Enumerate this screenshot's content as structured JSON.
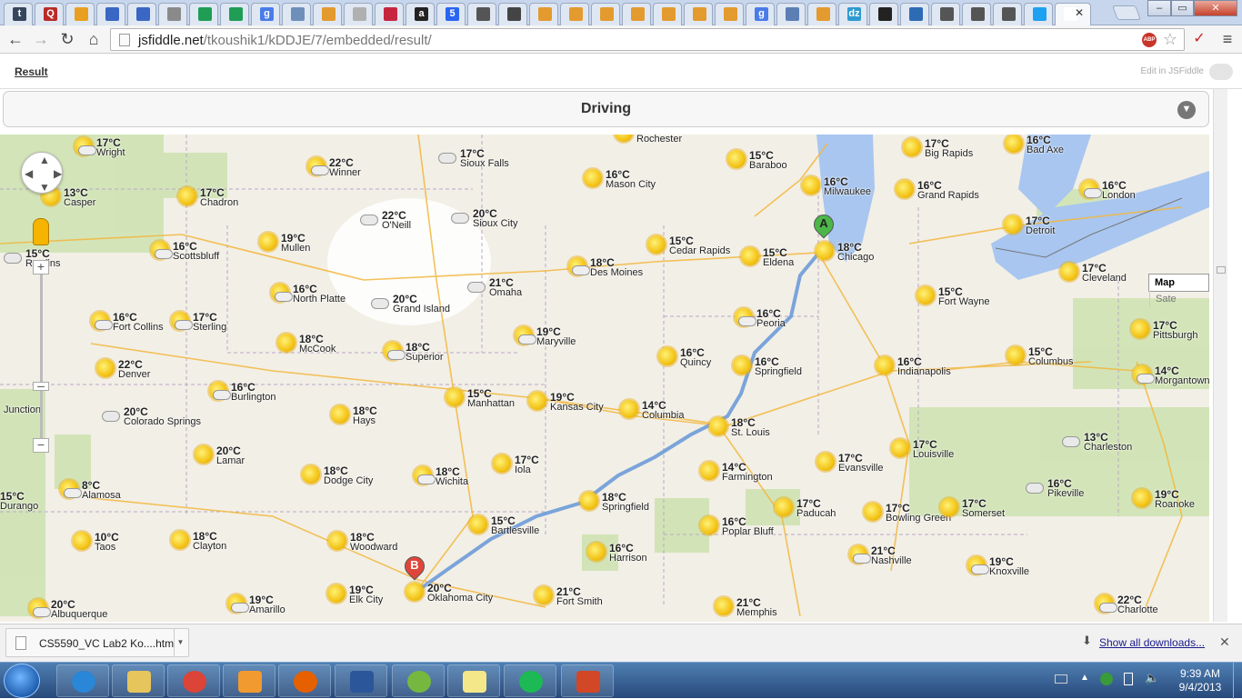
{
  "browser": {
    "address_host": "jsfiddle.net",
    "address_path": "/tkoushik1/kDDJE/7/embedded/result/",
    "tabs": [
      {
        "icon": "tumblr-icon",
        "color": "#35465c",
        "glyph": "t"
      },
      {
        "icon": "quora-icon",
        "color": "#b92b27",
        "glyph": "Q"
      },
      {
        "icon": "windows-icon",
        "color": "#e9a020",
        "glyph": ""
      },
      {
        "icon": "doc-icon",
        "color": "#3a66c4",
        "glyph": ""
      },
      {
        "icon": "doc-icon",
        "color": "#3a66c4",
        "glyph": ""
      },
      {
        "icon": "bb-icon",
        "color": "#8a8a8a",
        "glyph": ""
      },
      {
        "icon": "sheets-icon",
        "color": "#1f9d55",
        "glyph": ""
      },
      {
        "icon": "sheets-icon",
        "color": "#1f9d55",
        "glyph": ""
      },
      {
        "icon": "google-icon",
        "color": "#4a7ce8",
        "glyph": "g"
      },
      {
        "icon": "swirl-icon",
        "color": "#6d8fb9",
        "glyph": ""
      },
      {
        "icon": "stack-icon",
        "color": "#e39a2e",
        "glyph": ""
      },
      {
        "icon": "stack-icon",
        "color": "#b0b0b0",
        "glyph": ""
      },
      {
        "icon": "tw-icon",
        "color": "#c7253e",
        "glyph": ""
      },
      {
        "icon": "amazon-icon",
        "color": "#222222",
        "glyph": "a"
      },
      {
        "icon": "css-icon",
        "color": "#2965f1",
        "glyph": "5"
      },
      {
        "icon": "doc-icon",
        "color": "#555555",
        "glyph": ""
      },
      {
        "icon": "book-icon",
        "color": "#444444",
        "glyph": ""
      },
      {
        "icon": "stack-icon",
        "color": "#e39a2e",
        "glyph": ""
      },
      {
        "icon": "stack-icon",
        "color": "#e39a2e",
        "glyph": ""
      },
      {
        "icon": "stack-icon",
        "color": "#e39a2e",
        "glyph": ""
      },
      {
        "icon": "stack-icon",
        "color": "#e39a2e",
        "glyph": ""
      },
      {
        "icon": "stack-icon",
        "color": "#e39a2e",
        "glyph": ""
      },
      {
        "icon": "stack-icon",
        "color": "#e39a2e",
        "glyph": ""
      },
      {
        "icon": "stack-icon",
        "color": "#e39a2e",
        "glyph": ""
      },
      {
        "icon": "google-icon",
        "color": "#4a7ce8",
        "glyph": "g"
      },
      {
        "icon": "p-icon",
        "color": "#5b7fb5",
        "glyph": ""
      },
      {
        "icon": "stack-icon",
        "color": "#e39a2e",
        "glyph": ""
      },
      {
        "icon": "dzone-icon",
        "color": "#2e9ad0",
        "glyph": "dz"
      },
      {
        "icon": "github-icon",
        "color": "#222222",
        "glyph": ""
      },
      {
        "icon": "arrow-icon",
        "color": "#2e6bb5",
        "glyph": ""
      },
      {
        "icon": "mask-icon",
        "color": "#555555",
        "glyph": ""
      },
      {
        "icon": "mask-icon",
        "color": "#555555",
        "glyph": ""
      },
      {
        "icon": "mask-icon",
        "color": "#555555",
        "glyph": ""
      },
      {
        "icon": "twitter-icon",
        "color": "#1da1f2",
        "glyph": ""
      },
      {
        "icon": "blank-icon",
        "color": "#ffffff",
        "glyph": "",
        "active": true
      }
    ]
  },
  "fiddle": {
    "result_label": "Result",
    "edit_label": "Edit in JSFiddle"
  },
  "panel": {
    "mode": "Driving"
  },
  "map": {
    "type_buttons": [
      "Map",
      "Sate"
    ],
    "markers": [
      {
        "label": "A",
        "color": "#4cb648"
      },
      {
        "label": "B",
        "color": "#e0453a"
      }
    ],
    "weather": [
      {
        "t": "17°C",
        "c": "Wright",
        "k": "partly"
      },
      {
        "t": "22°C",
        "c": "Winner",
        "k": "partly"
      },
      {
        "t": "17°C",
        "c": "Sioux Falls",
        "k": "cloud"
      },
      {
        "t": "",
        "c": "Rochester",
        "k": "sun"
      },
      {
        "t": "15°C",
        "c": "Baraboo",
        "k": "sun"
      },
      {
        "t": "17°C",
        "c": "Big Rapids",
        "k": "sun"
      },
      {
        "t": "16°C",
        "c": "Bad Axe",
        "k": "sun"
      },
      {
        "t": "13°C",
        "c": "Casper",
        "k": "sun"
      },
      {
        "t": "17°C",
        "c": "Chadron",
        "k": "sun"
      },
      {
        "t": "16°C",
        "c": "Mason City",
        "k": "sun"
      },
      {
        "t": "16°C",
        "c": "Milwaukee",
        "k": "sun"
      },
      {
        "t": "16°C",
        "c": "Grand Rapids",
        "k": "sun"
      },
      {
        "t": "16°C",
        "c": "London",
        "k": "partly"
      },
      {
        "t": "22°C",
        "c": "O'Neill",
        "k": "cloud"
      },
      {
        "t": "20°C",
        "c": "Sioux City",
        "k": "cloud"
      },
      {
        "t": "17°C",
        "c": "Detroit",
        "k": "sun"
      },
      {
        "t": "15°C",
        "c": "Rawlins",
        "k": "cloud"
      },
      {
        "t": "16°C",
        "c": "Scottsbluff",
        "k": "partly"
      },
      {
        "t": "19°C",
        "c": "Mullen",
        "k": "sun"
      },
      {
        "t": "15°C",
        "c": "Cedar Rapids",
        "k": "sun"
      },
      {
        "t": "15°C",
        "c": "Eldena",
        "k": "sun"
      },
      {
        "t": "18°C",
        "c": "Chicago",
        "k": "sun"
      },
      {
        "t": "18°C",
        "c": "Des Moines",
        "k": "partly"
      },
      {
        "t": "21°C",
        "c": "Omaha",
        "k": "cloud"
      },
      {
        "t": "17°C",
        "c": "Cleveland",
        "k": "sun"
      },
      {
        "t": "16°C",
        "c": "North Platte",
        "k": "partly"
      },
      {
        "t": "20°C",
        "c": "Grand Island",
        "k": "cloud"
      },
      {
        "t": "15°C",
        "c": "Fort Wayne",
        "k": "sun"
      },
      {
        "t": "16°C",
        "c": "Fort Collins",
        "k": "partly"
      },
      {
        "t": "17°C",
        "c": "Sterling",
        "k": "partly"
      },
      {
        "t": "16°C",
        "c": "Peoria",
        "k": "partly"
      },
      {
        "t": "17°C",
        "c": "Pittsburgh",
        "k": "sun"
      },
      {
        "t": "18°C",
        "c": "McCook",
        "k": "sun"
      },
      {
        "t": "19°C",
        "c": "Maryville",
        "k": "partly"
      },
      {
        "t": "18°C",
        "c": "Superior",
        "k": "partly"
      },
      {
        "t": "16°C",
        "c": "Quincy",
        "k": "sun"
      },
      {
        "t": "16°C",
        "c": "Springfield",
        "k": "sun"
      },
      {
        "t": "16°C",
        "c": "Indianapolis",
        "k": "sun"
      },
      {
        "t": "15°C",
        "c": "Columbus",
        "k": "sun"
      },
      {
        "t": "14°C",
        "c": "Morgantown",
        "k": "partly"
      },
      {
        "t": "22°C",
        "c": "Denver",
        "k": "sun"
      },
      {
        "t": "16°C",
        "c": "Burlington",
        "k": "partly"
      },
      {
        "t": "15°C",
        "c": "Manhattan",
        "k": "sun"
      },
      {
        "t": "19°C",
        "c": "Kansas City",
        "k": "sun"
      },
      {
        "t": "14°C",
        "c": "Columbia",
        "k": "sun"
      },
      {
        "t": "18°C",
        "c": "Hays",
        "k": "sun"
      },
      {
        "t": "18°C",
        "c": "St. Louis",
        "k": "sun"
      },
      {
        "t": "20°C",
        "c": "Colorado Springs",
        "k": "cloud"
      },
      {
        "t": "13°C",
        "c": "Charleston",
        "k": "fog"
      },
      {
        "t": "17°C",
        "c": "Louisville",
        "k": "sun"
      },
      {
        "t": "20°C",
        "c": "Lamar",
        "k": "sun"
      },
      {
        "t": "17°C",
        "c": "Evansville",
        "k": "sun"
      },
      {
        "t": "17°C",
        "c": "Iola",
        "k": "sun"
      },
      {
        "t": "18°C",
        "c": "Dodge City",
        "k": "sun"
      },
      {
        "t": "18°C",
        "c": "Wichita",
        "k": "partly"
      },
      {
        "t": "14°C",
        "c": "Farmington",
        "k": "sun"
      },
      {
        "t": "8°C",
        "c": "Alamosa",
        "k": "partly"
      },
      {
        "t": "16°C",
        "c": "Pikeville",
        "k": "cloud"
      },
      {
        "t": "19°C",
        "c": "Roanoke",
        "k": "sun"
      },
      {
        "t": "15°C",
        "c": "Durango",
        "k": "sun"
      },
      {
        "t": "18°C",
        "c": "Springfield",
        "k": "sun"
      },
      {
        "t": "17°C",
        "c": "Paducah",
        "k": "sun"
      },
      {
        "t": "17°C",
        "c": "Bowling Green",
        "k": "sun"
      },
      {
        "t": "17°C",
        "c": "Somerset",
        "k": "sun"
      },
      {
        "t": "15°C",
        "c": "Bartlesville",
        "k": "sun"
      },
      {
        "t": "16°C",
        "c": "Poplar Bluff",
        "k": "sun"
      },
      {
        "t": "10°C",
        "c": "Taos",
        "k": "sun"
      },
      {
        "t": "18°C",
        "c": "Clayton",
        "k": "sun"
      },
      {
        "t": "18°C",
        "c": "Woodward",
        "k": "sun"
      },
      {
        "t": "16°C",
        "c": "Harrison",
        "k": "sun"
      },
      {
        "t": "21°C",
        "c": "Nashville",
        "k": "partly"
      },
      {
        "t": "19°C",
        "c": "Knoxville",
        "k": "partly"
      },
      {
        "t": "19°C",
        "c": "Elk City",
        "k": "sun"
      },
      {
        "t": "20°C",
        "c": "Oklahoma City",
        "k": "sun"
      },
      {
        "t": "21°C",
        "c": "Fort Smith",
        "k": "sun"
      },
      {
        "t": "20°C",
        "c": "Albuquerque",
        "k": "partly"
      },
      {
        "t": "19°C",
        "c": "Amarillo",
        "k": "partly"
      },
      {
        "t": "21°C",
        "c": "Memphis",
        "k": "sun"
      },
      {
        "t": "22°C",
        "c": "Charlotte",
        "k": "partly"
      },
      {
        "t": "",
        "c": "Junction",
        "k": "none"
      }
    ]
  },
  "downloads": {
    "file": "CS5590_VC Lab2 Ko....htm",
    "show_all": "Show all downloads..."
  },
  "taskbar": {
    "apps": [
      {
        "name": "ie-icon",
        "color": "#2a86d6"
      },
      {
        "name": "explorer-icon",
        "color": "#e6c55c"
      },
      {
        "name": "chrome-icon",
        "color": "#db4437"
      },
      {
        "name": "media-icon",
        "color": "#f19a2f"
      },
      {
        "name": "firefox-icon",
        "color": "#e66000"
      },
      {
        "name": "word-icon",
        "color": "#2b579a"
      },
      {
        "name": "utorrent-icon",
        "color": "#76b83f"
      },
      {
        "name": "notes-icon",
        "color": "#f3e78a"
      },
      {
        "name": "spotify-icon",
        "color": "#1db954"
      },
      {
        "name": "powerpoint-icon",
        "color": "#d24726"
      }
    ],
    "time": "9:39 AM",
    "date": "9/4/2013"
  }
}
